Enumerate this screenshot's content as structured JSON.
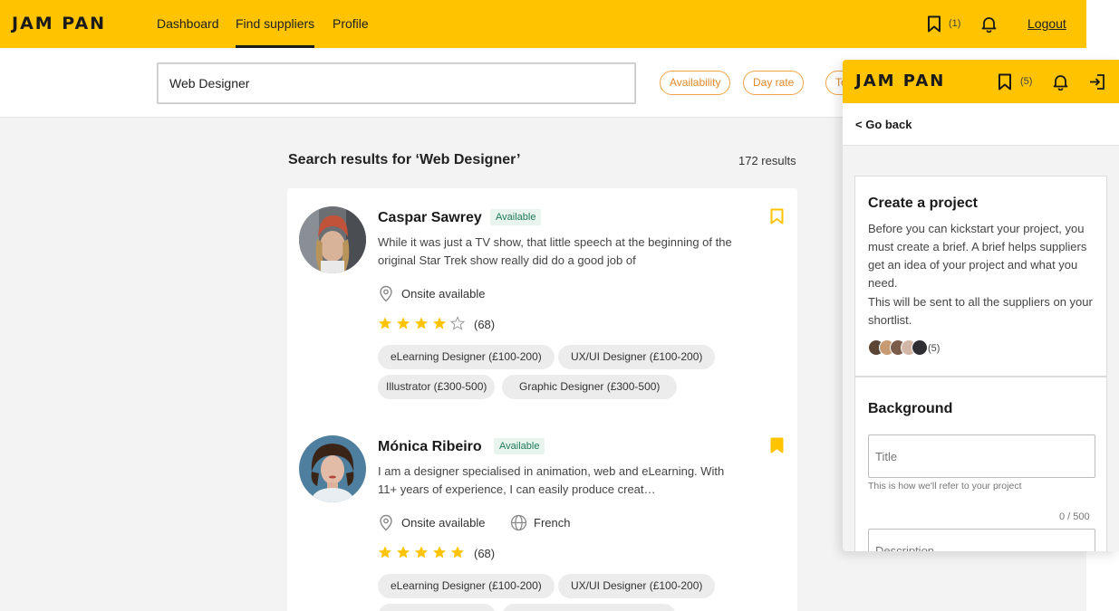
{
  "brand": {
    "logo_text": "JAM PAN",
    "accent": "#ffc300",
    "available_green": "#1f7a55",
    "star_color": "#ffc300",
    "pill_color": "#e08a2a"
  },
  "nav": {
    "items": [
      {
        "label": "Dashboard"
      },
      {
        "label": "Find suppliers"
      },
      {
        "label": "Profile"
      }
    ],
    "active": "Find suppliers",
    "bookmark_count": "(1)",
    "logout_label": "Logout",
    "icons": [
      "bookmark-icon",
      "bell-icon"
    ]
  },
  "search": {
    "value": "Web Designer",
    "filters": [
      "Availability",
      "Day rate",
      "To"
    ]
  },
  "results": {
    "title": "Search results for ‘Web Designer’",
    "count": "172 results",
    "suppliers": [
      {
        "name": "Caspar Sawrey",
        "status": "Available",
        "description": "While it was just a TV show, that little speech at the beginning of the original Star Trek show really did do a good job of",
        "location": "Onsite available",
        "language": "",
        "rating": 4,
        "reviews": "(68)",
        "bookmarked": false,
        "tags": [
          "eLearning Designer (£100-200)",
          "UX/UI Designer (£100-200)",
          "Illustrator (£300-500)",
          "Graphic Designer (£300-500)"
        ]
      },
      {
        "name": "Mónica Ribeiro",
        "status": "Available",
        "description": "I am a designer specialised in animation, web and eLearning. With 11+ years of experience, I can easily produce creat…",
        "location": "Onsite available",
        "language": "French",
        "rating": 5,
        "reviews": "(68)",
        "bookmarked": true,
        "tags": [
          "eLearning Designer (£100-200)",
          "UX/UI Designer (£100-200)"
        ]
      }
    ]
  },
  "panel": {
    "logo_text": "JAM PAN",
    "bookmark_count": "(5)",
    "icons": [
      "bookmark-icon",
      "bell-icon",
      "exit-icon"
    ],
    "go_back": "< Go back",
    "create": {
      "title": "Create a project",
      "text1": "Before you can kickstart your project, you must create a brief. A brief helps suppliers get an idea of your project and what you need.",
      "text2": "This will be sent to all the suppliers on your shortlist.",
      "shortlist_count": "(5)"
    },
    "background": {
      "title": "Background",
      "title_placeholder": "Title",
      "title_helper": "This is how we'll refer to your project",
      "counter": "0 / 500",
      "description_placeholder": "Description"
    }
  }
}
